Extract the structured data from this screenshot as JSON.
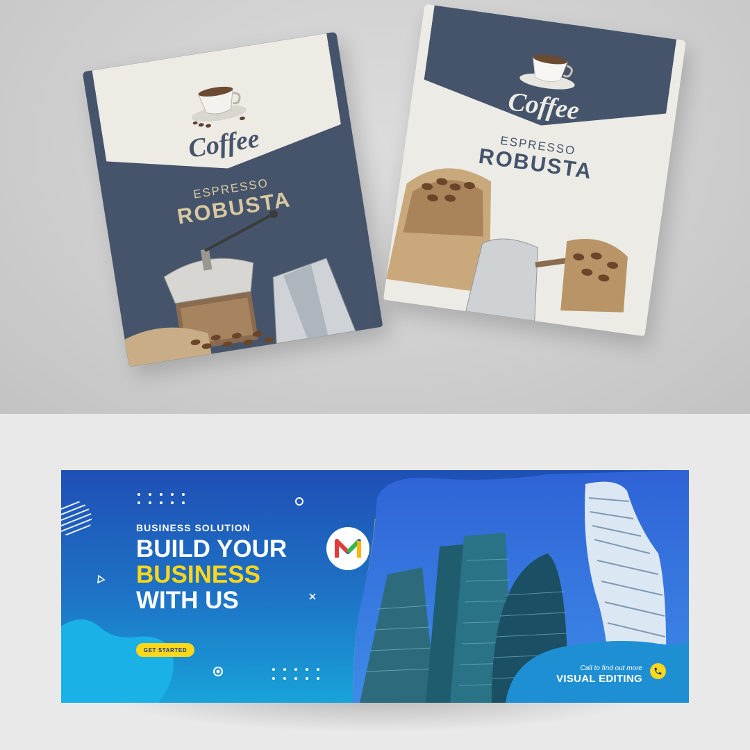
{
  "coffee_bags": [
    {
      "variant": "navy",
      "brand_text": "Coffee",
      "sub_text": "ESPRESSO",
      "product_text": "ROBUSTA",
      "colors": {
        "bag": "#45546a",
        "label": "#eeeae4",
        "accent": "#d8c9a3"
      }
    },
    {
      "variant": "cream",
      "brand_text": "Coffee",
      "sub_text": "ESPRESSO",
      "product_text": "ROBUSTA",
      "colors": {
        "bag": "#ecebe6",
        "label": "#45546a",
        "accent": "#45546a"
      }
    }
  ],
  "banner": {
    "eyebrow": "BUSINESS SOLUTION",
    "headline_line1": "BUILD YOUR",
    "headline_line2": "BUSINESS",
    "headline_line3": "WITH US",
    "cta_label": "GET STARTED",
    "contact_small": "Call to find out more",
    "contact_big": "VISUAL EDITING",
    "logo_letter": "M",
    "icons": [
      "phone-icon",
      "logo-icon",
      "dots-pattern-icon",
      "circle-icon",
      "triangle-icon",
      "cross-icon",
      "striped-circle-icon"
    ],
    "colors": {
      "primary": "#1f5fbf",
      "accent": "#ffd71a",
      "text": "#ffffff"
    }
  }
}
